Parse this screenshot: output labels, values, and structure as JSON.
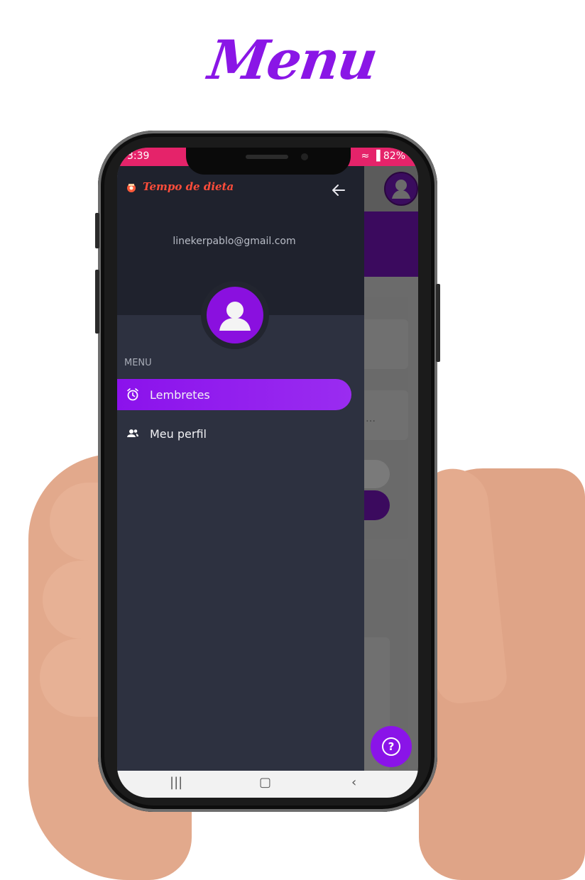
{
  "headline": "Menu",
  "status": {
    "time": "3:39",
    "battery": "82%"
  },
  "drawer": {
    "app_name": "Tempo de dieta",
    "email": "linekerpablo@gmail.com",
    "section_label": "MENU",
    "items": [
      {
        "label": "Lembretes",
        "icon": "alarm-clock-icon",
        "active": true
      },
      {
        "label": "Meu perfil",
        "icon": "people-icon",
        "active": false
      }
    ]
  },
  "background_app": {
    "help_icon": "question-circle-icon"
  },
  "colors": {
    "accent": "#8a10df",
    "status_bar": "#e5236a",
    "drawer_bg": "#2d3140",
    "drawer_header_bg": "#1f222d",
    "app_name": "#ff4d3a"
  }
}
